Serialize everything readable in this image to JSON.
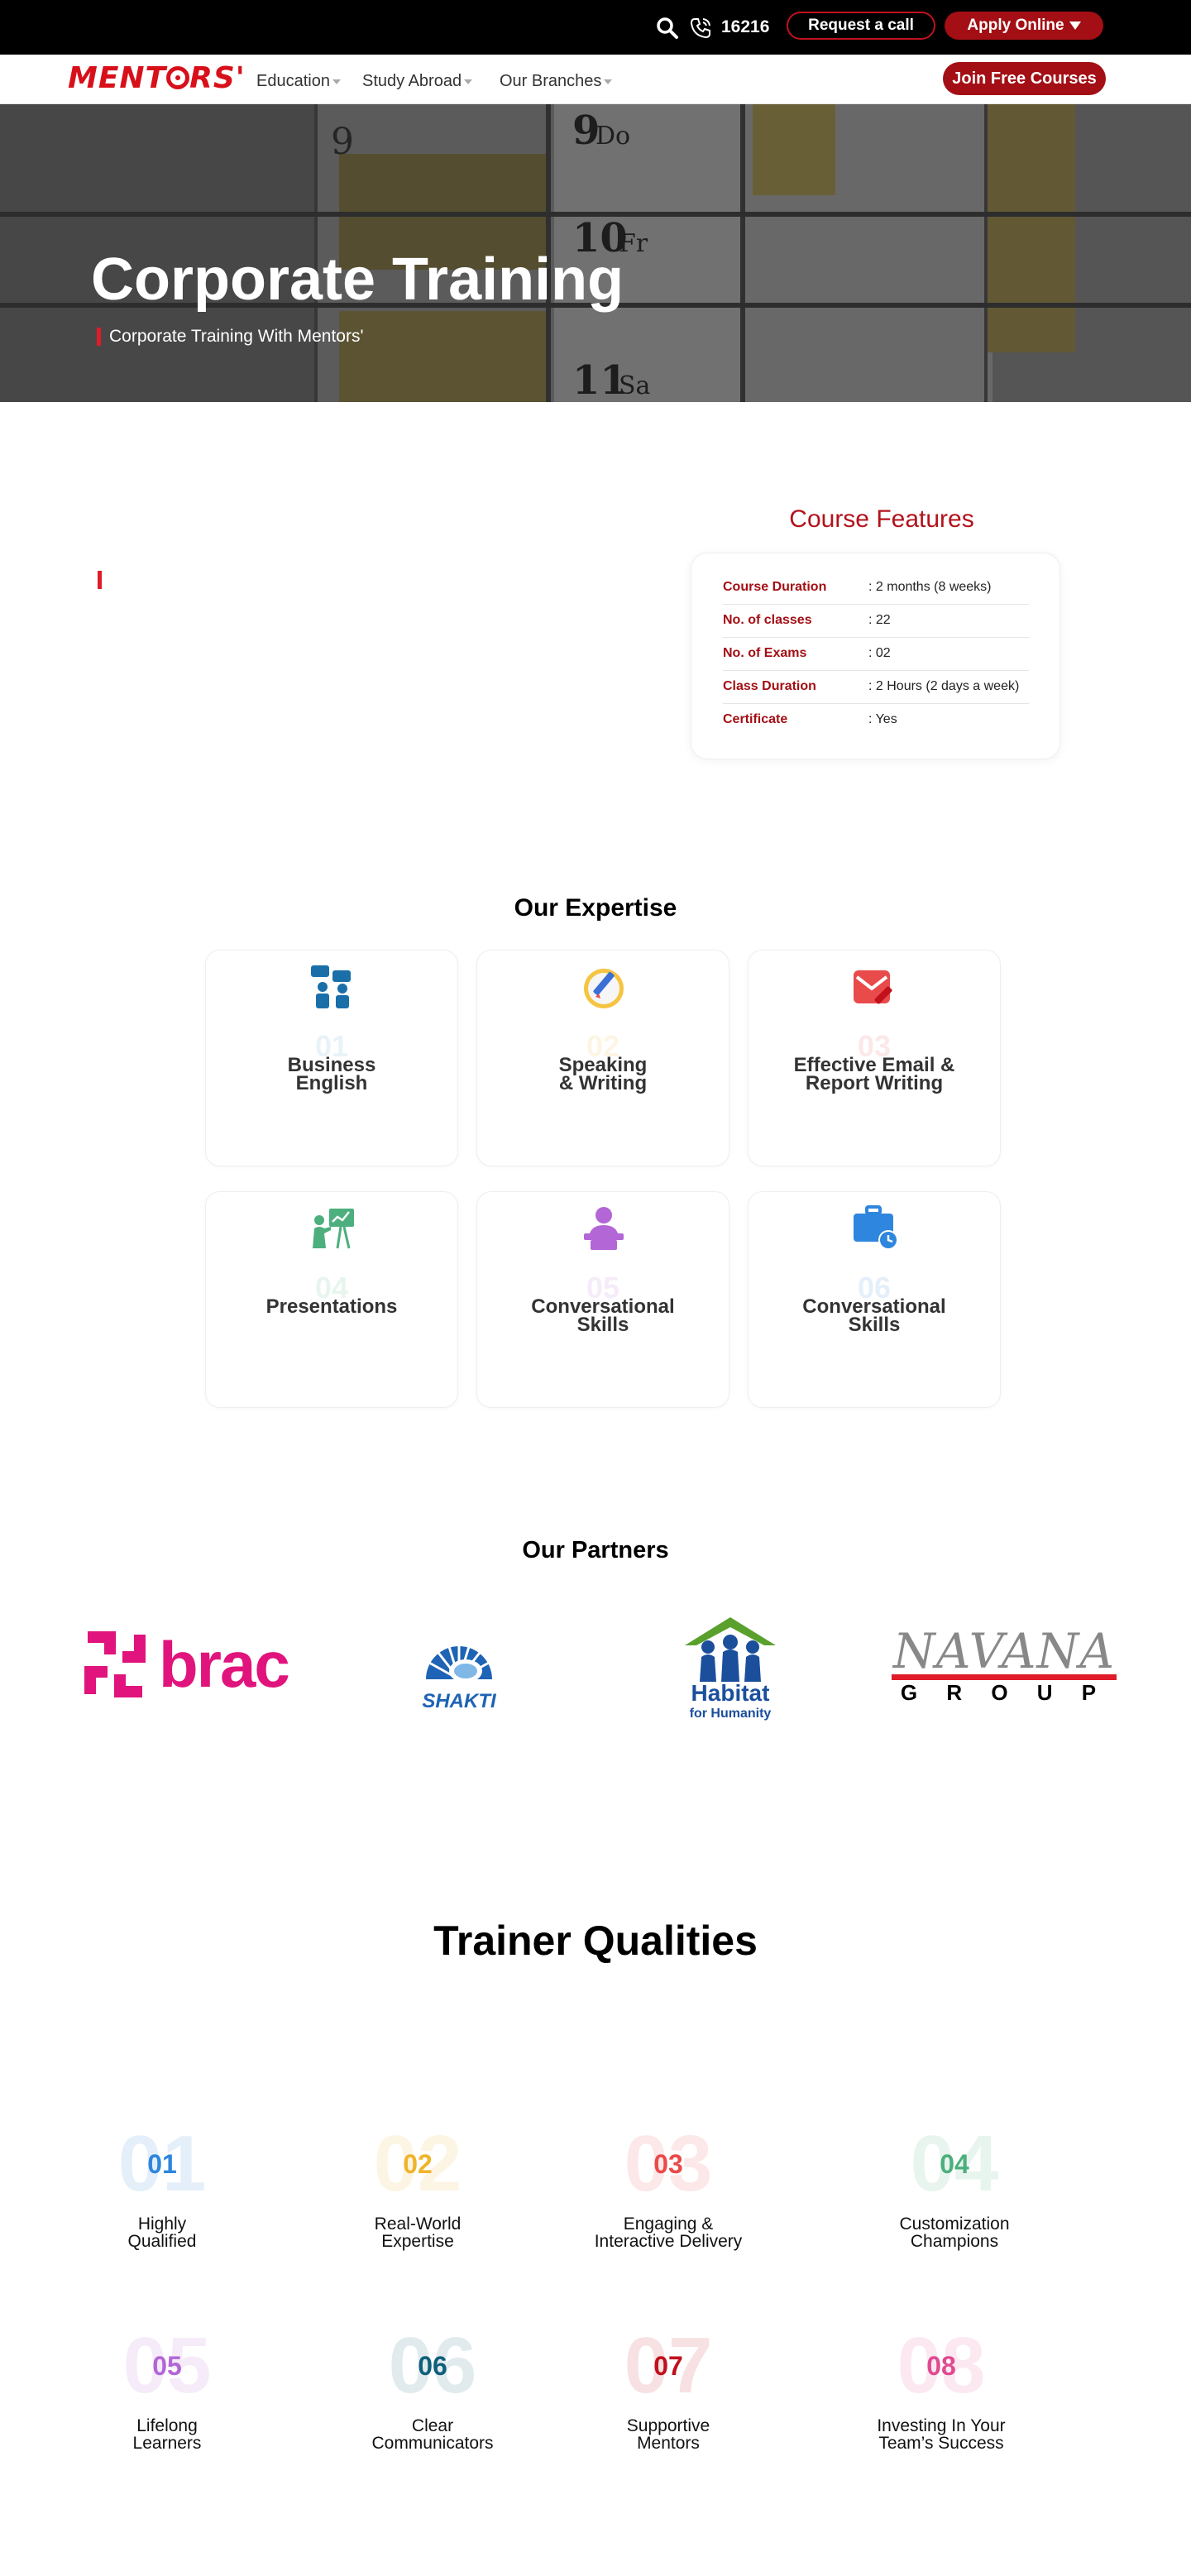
{
  "topbar": {
    "phone_number": "16216",
    "request_call_label": "Request a call",
    "apply_online_label": "Apply Online"
  },
  "nav": {
    "logo_text": "MENT",
    "logo_text_end": "RS'",
    "items": [
      {
        "label": "Education"
      },
      {
        "label": "Study Abroad"
      },
      {
        "label": "Our Branches"
      }
    ],
    "join_label": "Join Free Courses"
  },
  "hero": {
    "title": "Corporate Training",
    "subtitle": "Corporate Training With Mentors'"
  },
  "course_features": {
    "title": "Course Features",
    "rows": [
      {
        "label": "Course Duration",
        "value": ": 2 months (8 weeks)"
      },
      {
        "label": "No. of classes",
        "value": ": 22"
      },
      {
        "label": "No. of Exams",
        "value": ": 02"
      },
      {
        "label": "Class Duration",
        "value": ": 2 Hours (2 days a week)"
      },
      {
        "label": "Certificate",
        "value": ": Yes"
      }
    ]
  },
  "expertise": {
    "title": "Our Expertise",
    "cards": [
      {
        "num": "01",
        "label_line1": "Business",
        "label_line2": "English",
        "icon": "business-english-icon",
        "color": "#4aa3d6"
      },
      {
        "num": "02",
        "label_line1": "Speaking",
        "label_line2": "& Writing",
        "icon": "speaking-writing-icon",
        "color": "#f0b429"
      },
      {
        "num": "03",
        "label_line1": "Effective Email &",
        "label_line2": "Report Writing",
        "icon": "email-icon",
        "color": "#e94b4b"
      },
      {
        "num": "04",
        "label_line1": "Presentations",
        "label_line2": "",
        "icon": "presentation-icon",
        "color": "#4caf7d"
      },
      {
        "num": "05",
        "label_line1": "Conversational",
        "label_line2": "Skills",
        "icon": "conversation-icon",
        "color": "#b366d6"
      },
      {
        "num": "06",
        "label_line1": "Conversational",
        "label_line2": "Skills",
        "icon": "briefcase-clock-icon",
        "color": "#2e86de"
      }
    ]
  },
  "partners": {
    "title": "Our Partners",
    "logos": [
      {
        "name": "brac",
        "text": "brac",
        "color": "#e0147c"
      },
      {
        "name": "shakti",
        "text": "SHAKTI",
        "color": "#1e63b5"
      },
      {
        "name": "habitat",
        "text_line1": "Habitat",
        "text_line2": "for Humanity",
        "color": "#1b4f9c"
      },
      {
        "name": "navana",
        "text_line1": "NAVANA",
        "text_line2": "G R O U P",
        "color": "#888888"
      }
    ]
  },
  "trainer": {
    "title": "Trainer Qualities",
    "items": [
      {
        "num": "01",
        "label_line1": "Highly",
        "label_line2": "Qualified",
        "color": "#2e86de"
      },
      {
        "num": "02",
        "label_line1": "Real-World",
        "label_line2": "Expertise",
        "color": "#f0b429"
      },
      {
        "num": "03",
        "label_line1": "Engaging &",
        "label_line2": "Interactive Delivery",
        "color": "#e94b4b"
      },
      {
        "num": "04",
        "label_line1": "Customization",
        "label_line2": "Champions",
        "color": "#4caf7d"
      },
      {
        "num": "05",
        "label_line1": "Lifelong",
        "label_line2": "Learners",
        "color": "#b366d6"
      },
      {
        "num": "06",
        "label_line1": "Clear",
        "label_line2": "Communicators",
        "color": "#0f5f7a"
      },
      {
        "num": "07",
        "label_line1": "Supportive",
        "label_line2": "Mentors",
        "color": "#c0111d"
      },
      {
        "num": "08",
        "label_line1": "Investing In Your",
        "label_line2": "Team’s Success",
        "color": "#e04a92"
      }
    ]
  }
}
